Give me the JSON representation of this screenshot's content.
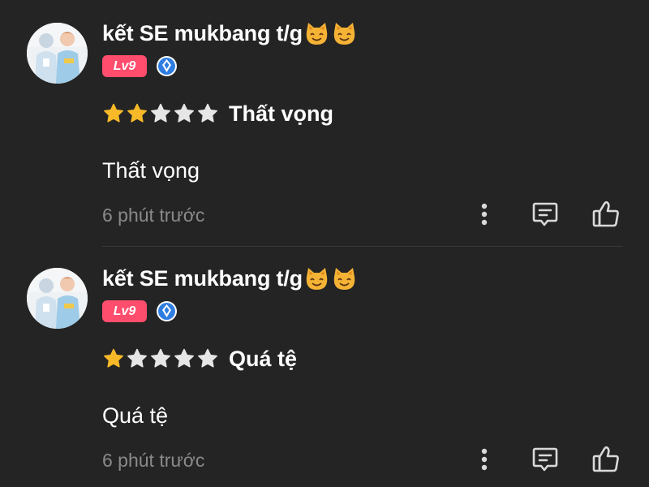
{
  "comments": [
    {
      "username": "kết SE mukbang t/g",
      "username_icons": [
        "cat-face-icon",
        "cat-face-icon"
      ],
      "level": "Lv9",
      "verified_icon": "diamond-badge-icon",
      "rating": 2,
      "rating_max": 5,
      "rating_label": "Thất vọng",
      "body": "Thất vọng",
      "timestamp": "6 phút trước"
    },
    {
      "username": "kết SE mukbang t/g",
      "username_icons": [
        "cat-face-icon",
        "cat-face-icon"
      ],
      "level": "Lv9",
      "verified_icon": "diamond-badge-icon",
      "rating": 1,
      "rating_max": 5,
      "rating_label": "Quá tệ",
      "body": "Quá tệ",
      "timestamp": "6 phút trước"
    }
  ],
  "actions": {
    "more_icon": "more-vertical-icon",
    "reply_icon": "comment-icon",
    "like_icon": "thumbs-up-icon"
  },
  "colors": {
    "background": "#242424",
    "text": "#ffffff",
    "muted": "#8a8a8a",
    "star_filled": "#f7b928",
    "star_empty": "#e6e6e6",
    "level_badge": "#ff4d6d",
    "verify_badge": "#2f7de1",
    "divider": "#3a3a3a"
  }
}
